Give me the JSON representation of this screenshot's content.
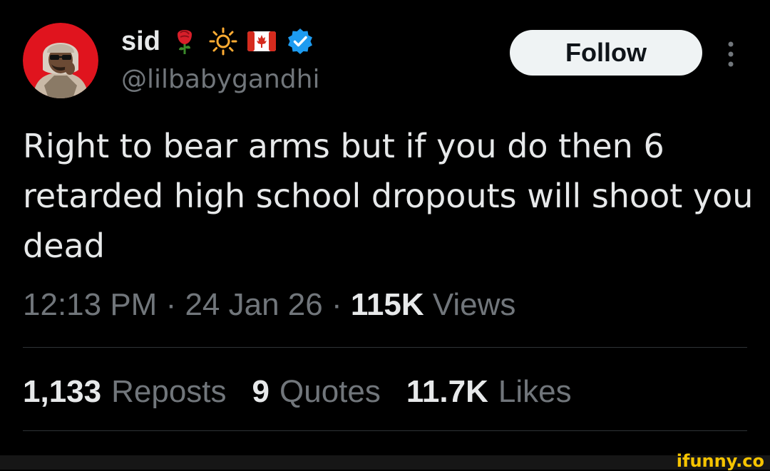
{
  "author": {
    "display_name": "sid",
    "handle": "@lilbabygandhi",
    "name_emojis": [
      "rose-icon",
      "sun-icon",
      "canada-flag-icon"
    ],
    "verified": true,
    "verified_color": "#1d9bf0"
  },
  "follow_button": {
    "label": "Follow"
  },
  "tweet": {
    "text": "Right to bear arms but if you do then 6 retarded high school dropouts will shoot you dead"
  },
  "meta": {
    "time": "12:13 PM",
    "separator": " · ",
    "date": "24 Jan 26",
    "views_count": "115K",
    "views_label": " Views"
  },
  "stats": [
    {
      "count": "1,133",
      "label": "Reposts"
    },
    {
      "count": "9",
      "label": "Quotes"
    },
    {
      "count": "11.7K",
      "label": "Likes"
    }
  ],
  "watermark": "ifunny.co",
  "colors": {
    "background": "#000000",
    "text_primary": "#e7e9ea",
    "text_secondary": "#71767b",
    "divider": "#2f3336",
    "avatar_bg": "#e0141e",
    "watermark": "#f6c400"
  }
}
